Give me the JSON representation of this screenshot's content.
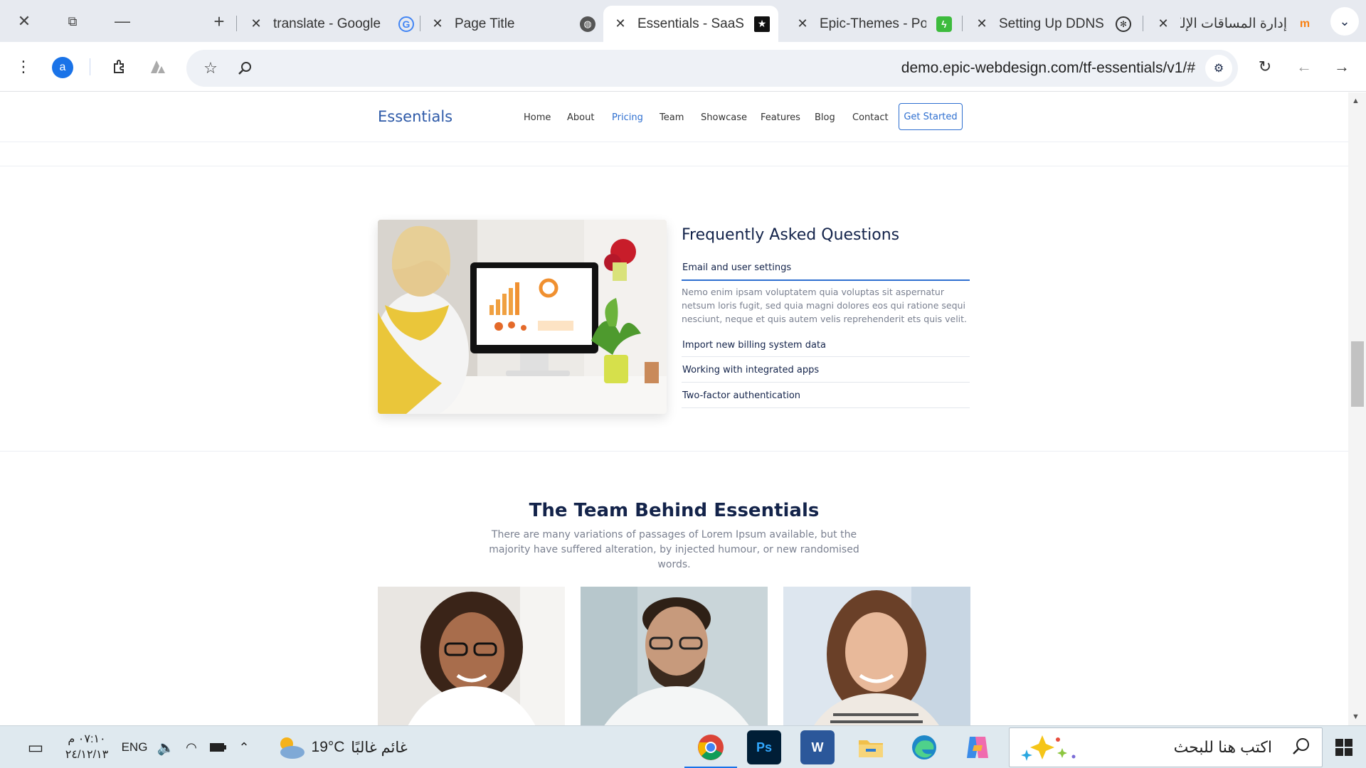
{
  "browser": {
    "tabs": [
      {
        "title": "translate - Google",
        "favicon": "google-g-icon"
      },
      {
        "title": "Page Title",
        "favicon": "globe-icon"
      },
      {
        "title": "Essentials - SaaS Landing",
        "favicon": "star-square-icon",
        "active": true
      },
      {
        "title": "Epic-Themes - Portfolio",
        "favicon": "lightning-green-icon"
      },
      {
        "title": "Setting Up DDNS",
        "favicon": "openai-icon"
      },
      {
        "title": "إدارة المساقات الإلكترونية",
        "favicon": "moodle-icon"
      }
    ],
    "profile_initial": "a",
    "url": "demo.epic-webdesign.com/tf-essentials/v1/#"
  },
  "site": {
    "brand": "Essentials",
    "nav": [
      "Home",
      "About",
      "Pricing",
      "Team",
      "Showcase",
      "Features",
      "Blog",
      "Contact"
    ],
    "active_nav": "Pricing",
    "cta": "Get Started",
    "accent_color": "#2e6fd0",
    "faq": {
      "title": "Frequently Asked Questions",
      "items": [
        {
          "q": "Email and user settings",
          "a": "Nemo enim ipsam voluptatem quia voluptas sit aspernatur netsum loris fugit, sed quia magni dolores eos qui ratione sequi nesciunt, neque et quis autem velis reprehenderit ets quis velit.",
          "open": true
        },
        {
          "q": "Import new billing system data"
        },
        {
          "q": "Working with integrated apps"
        },
        {
          "q": "Two-factor authentication"
        }
      ]
    },
    "team": {
      "title": "The Team Behind Essentials",
      "subtitle": "There are many variations of passages of Lorem Ipsum available, but the majority have suffered alteration, by injected humour, or new randomised words."
    }
  },
  "taskbar": {
    "time": "٠٧:١٠ م",
    "date": "٢٤/١٢/١٣",
    "lang": "ENG",
    "weather_temp": "19°C",
    "weather_text": "غائم غالبًا",
    "search_placeholder": "اكتب هنا للبحث"
  }
}
